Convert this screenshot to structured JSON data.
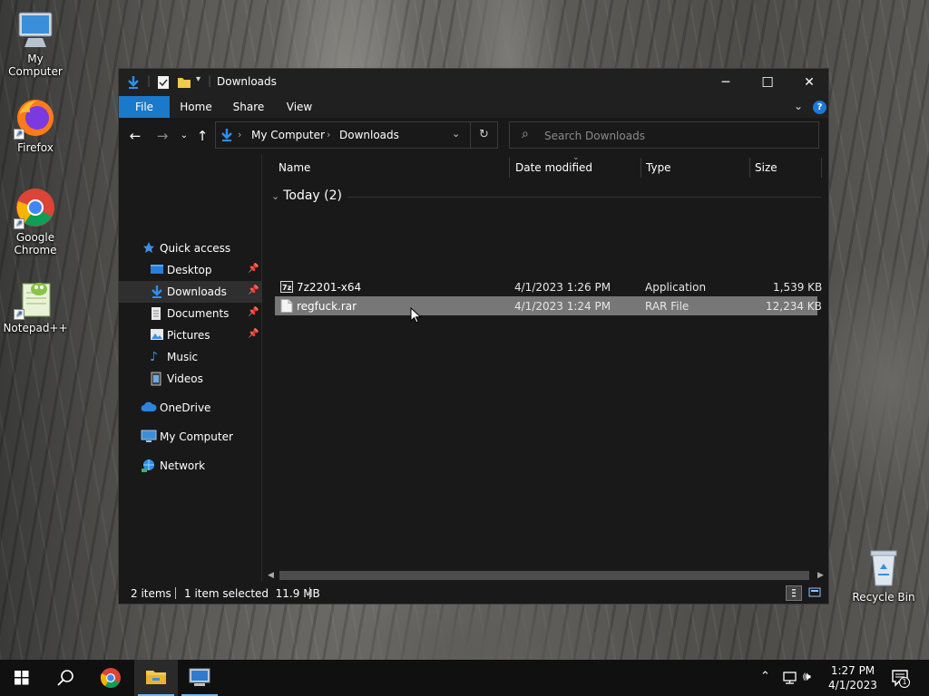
{
  "desktop": {
    "icons": [
      {
        "label": "My Computer",
        "icon": "computer-icon"
      },
      {
        "label": "Firefox",
        "icon": "firefox-icon"
      },
      {
        "label": "Google Chrome",
        "icon": "chrome-icon"
      },
      {
        "label": "Notepad++",
        "icon": "notepadpp-icon"
      },
      {
        "label": "Recycle Bin",
        "icon": "recycle-bin-icon"
      }
    ]
  },
  "window": {
    "title": "Downloads",
    "controls": {
      "minimize": "─",
      "maximize": "☐",
      "close": "✕"
    }
  },
  "ribbon": {
    "tabs": [
      {
        "label": "File"
      },
      {
        "label": "Home"
      },
      {
        "label": "Share"
      },
      {
        "label": "View"
      }
    ],
    "help": "?"
  },
  "address": {
    "breadcrumbs": [
      "My Computer",
      "Downloads"
    ]
  },
  "search": {
    "placeholder": "Search Downloads"
  },
  "navpane": {
    "items": [
      {
        "label": "Quick access",
        "icon": "star-icon",
        "pinned": false
      },
      {
        "label": "Desktop",
        "icon": "desktop-folder-icon",
        "pinned": true
      },
      {
        "label": "Downloads",
        "icon": "download-arrow-icon",
        "pinned": true
      },
      {
        "label": "Documents",
        "icon": "documents-icon",
        "pinned": true
      },
      {
        "label": "Pictures",
        "icon": "pictures-icon",
        "pinned": true
      },
      {
        "label": "Music",
        "icon": "music-icon",
        "pinned": false
      },
      {
        "label": "Videos",
        "icon": "videos-icon",
        "pinned": false
      },
      {
        "label": "OneDrive",
        "icon": "cloud-icon",
        "pinned": false
      },
      {
        "label": "My Computer",
        "icon": "computer-icon",
        "pinned": false
      },
      {
        "label": "Network",
        "icon": "network-icon",
        "pinned": false
      }
    ]
  },
  "columns": {
    "name": "Name",
    "date": "Date modified",
    "type": "Type",
    "size": "Size"
  },
  "group": {
    "label": "Today (2)"
  },
  "files": [
    {
      "name": "7z2201-x64",
      "date": "4/1/2023 1:26 PM",
      "type": "Application",
      "size": "1,539 KB",
      "icon": "application-icon"
    },
    {
      "name": "regfuck.rar",
      "date": "4/1/2023 1:24 PM",
      "type": "RAR File",
      "size": "12,234 KB",
      "icon": "blank-file-icon"
    }
  ],
  "status": {
    "count": "2 items",
    "selected": "1 item selected  11.9 MB"
  },
  "taskbar": {
    "time": "1:27 PM",
    "date": "4/1/2023",
    "notification_count": "1"
  }
}
